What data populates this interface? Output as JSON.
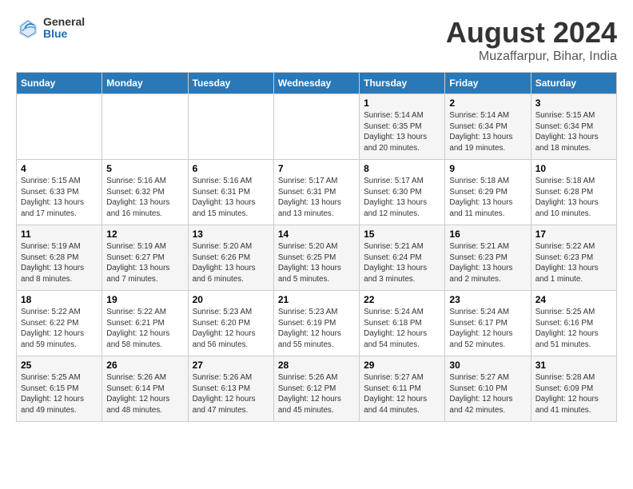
{
  "header": {
    "logo_general": "General",
    "logo_blue": "Blue",
    "title": "August 2024",
    "subtitle": "Muzaffarpur, Bihar, India"
  },
  "days_of_week": [
    "Sunday",
    "Monday",
    "Tuesday",
    "Wednesday",
    "Thursday",
    "Friday",
    "Saturday"
  ],
  "weeks": [
    [
      {
        "num": "",
        "info": ""
      },
      {
        "num": "",
        "info": ""
      },
      {
        "num": "",
        "info": ""
      },
      {
        "num": "",
        "info": ""
      },
      {
        "num": "1",
        "info": "Sunrise: 5:14 AM\nSunset: 6:35 PM\nDaylight: 13 hours\nand 20 minutes."
      },
      {
        "num": "2",
        "info": "Sunrise: 5:14 AM\nSunset: 6:34 PM\nDaylight: 13 hours\nand 19 minutes."
      },
      {
        "num": "3",
        "info": "Sunrise: 5:15 AM\nSunset: 6:34 PM\nDaylight: 13 hours\nand 18 minutes."
      }
    ],
    [
      {
        "num": "4",
        "info": "Sunrise: 5:15 AM\nSunset: 6:33 PM\nDaylight: 13 hours\nand 17 minutes."
      },
      {
        "num": "5",
        "info": "Sunrise: 5:16 AM\nSunset: 6:32 PM\nDaylight: 13 hours\nand 16 minutes."
      },
      {
        "num": "6",
        "info": "Sunrise: 5:16 AM\nSunset: 6:31 PM\nDaylight: 13 hours\nand 15 minutes."
      },
      {
        "num": "7",
        "info": "Sunrise: 5:17 AM\nSunset: 6:31 PM\nDaylight: 13 hours\nand 13 minutes."
      },
      {
        "num": "8",
        "info": "Sunrise: 5:17 AM\nSunset: 6:30 PM\nDaylight: 13 hours\nand 12 minutes."
      },
      {
        "num": "9",
        "info": "Sunrise: 5:18 AM\nSunset: 6:29 PM\nDaylight: 13 hours\nand 11 minutes."
      },
      {
        "num": "10",
        "info": "Sunrise: 5:18 AM\nSunset: 6:28 PM\nDaylight: 13 hours\nand 10 minutes."
      }
    ],
    [
      {
        "num": "11",
        "info": "Sunrise: 5:19 AM\nSunset: 6:28 PM\nDaylight: 13 hours\nand 8 minutes."
      },
      {
        "num": "12",
        "info": "Sunrise: 5:19 AM\nSunset: 6:27 PM\nDaylight: 13 hours\nand 7 minutes."
      },
      {
        "num": "13",
        "info": "Sunrise: 5:20 AM\nSunset: 6:26 PM\nDaylight: 13 hours\nand 6 minutes."
      },
      {
        "num": "14",
        "info": "Sunrise: 5:20 AM\nSunset: 6:25 PM\nDaylight: 13 hours\nand 5 minutes."
      },
      {
        "num": "15",
        "info": "Sunrise: 5:21 AM\nSunset: 6:24 PM\nDaylight: 13 hours\nand 3 minutes."
      },
      {
        "num": "16",
        "info": "Sunrise: 5:21 AM\nSunset: 6:23 PM\nDaylight: 13 hours\nand 2 minutes."
      },
      {
        "num": "17",
        "info": "Sunrise: 5:22 AM\nSunset: 6:23 PM\nDaylight: 13 hours\nand 1 minute."
      }
    ],
    [
      {
        "num": "18",
        "info": "Sunrise: 5:22 AM\nSunset: 6:22 PM\nDaylight: 12 hours\nand 59 minutes."
      },
      {
        "num": "19",
        "info": "Sunrise: 5:22 AM\nSunset: 6:21 PM\nDaylight: 12 hours\nand 58 minutes."
      },
      {
        "num": "20",
        "info": "Sunrise: 5:23 AM\nSunset: 6:20 PM\nDaylight: 12 hours\nand 56 minutes."
      },
      {
        "num": "21",
        "info": "Sunrise: 5:23 AM\nSunset: 6:19 PM\nDaylight: 12 hours\nand 55 minutes."
      },
      {
        "num": "22",
        "info": "Sunrise: 5:24 AM\nSunset: 6:18 PM\nDaylight: 12 hours\nand 54 minutes."
      },
      {
        "num": "23",
        "info": "Sunrise: 5:24 AM\nSunset: 6:17 PM\nDaylight: 12 hours\nand 52 minutes."
      },
      {
        "num": "24",
        "info": "Sunrise: 5:25 AM\nSunset: 6:16 PM\nDaylight: 12 hours\nand 51 minutes."
      }
    ],
    [
      {
        "num": "25",
        "info": "Sunrise: 5:25 AM\nSunset: 6:15 PM\nDaylight: 12 hours\nand 49 minutes."
      },
      {
        "num": "26",
        "info": "Sunrise: 5:26 AM\nSunset: 6:14 PM\nDaylight: 12 hours\nand 48 minutes."
      },
      {
        "num": "27",
        "info": "Sunrise: 5:26 AM\nSunset: 6:13 PM\nDaylight: 12 hours\nand 47 minutes."
      },
      {
        "num": "28",
        "info": "Sunrise: 5:26 AM\nSunset: 6:12 PM\nDaylight: 12 hours\nand 45 minutes."
      },
      {
        "num": "29",
        "info": "Sunrise: 5:27 AM\nSunset: 6:11 PM\nDaylight: 12 hours\nand 44 minutes."
      },
      {
        "num": "30",
        "info": "Sunrise: 5:27 AM\nSunset: 6:10 PM\nDaylight: 12 hours\nand 42 minutes."
      },
      {
        "num": "31",
        "info": "Sunrise: 5:28 AM\nSunset: 6:09 PM\nDaylight: 12 hours\nand 41 minutes."
      }
    ]
  ]
}
